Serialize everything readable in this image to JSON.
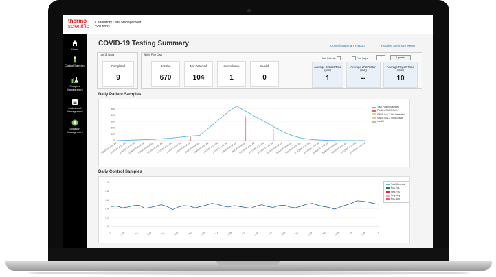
{
  "app": {
    "logo_line1": "thermo",
    "logo_line2": "scientific",
    "name": "Laboratory Data Management Solutions"
  },
  "sidebar": {
    "items": [
      {
        "label": "Home",
        "icon": "home-icon"
      },
      {
        "label": "Control Samples",
        "icon": "test-tube-icon"
      },
      {
        "label": "Reagent Management",
        "icon": "flask-icon"
      },
      {
        "label": "Instrument Management",
        "icon": "instrument-icon"
      },
      {
        "label": "Location Management",
        "icon": "location-icon"
      }
    ]
  },
  "page": {
    "title": "COVID-19 Testing Summary",
    "links": {
      "control": "Control Summary Report",
      "positive": "Positive Summary Report"
    }
  },
  "last24": {
    "label": "Last 24 hours",
    "cards": [
      {
        "label": "Completed",
        "value": "9"
      }
    ]
  },
  "within": {
    "label": "Within Prior Days",
    "cards": [
      {
        "label": "Positive",
        "value": "670"
      },
      {
        "label": "Not Detected",
        "value": "104"
      },
      {
        "label": "Inconclusive",
        "value": "1"
      },
      {
        "label": "Invalid",
        "value": "0"
      }
    ],
    "time_cards": [
      {
        "label": "Average Extract Time (min)",
        "value": "1"
      },
      {
        "label": "Average qPCR Start (min)",
        "value": "--"
      },
      {
        "label": "Average Report Time (min)",
        "value": "10"
      }
    ],
    "controls": {
      "auto_refresh": "Auto Refresh",
      "prior_days": "Prior Days",
      "prior_days_value": "7",
      "update": "Update"
    }
  },
  "colors": {
    "accent": "#1e6fb8",
    "brand": "#e3120b",
    "line": "#5ab4e5",
    "positive": "#e06666"
  },
  "chart_data": [
    {
      "type": "line",
      "title": "Daily Patient Samples",
      "yticks": [
        "0",
        "100",
        "200",
        "300",
        "400",
        "500"
      ],
      "ylim": [
        0,
        560
      ],
      "x": [
        "1/26/2020 12:00 AM",
        "1/27/2020 12:00 AM",
        "1/28/2020 12:00 AM",
        "1/29/2020 12:00 AM",
        "1/30/2020 12:00 AM",
        "1/31/2020 12:00 AM",
        "2/1/2020 12:00 AM",
        "2/2/2020 12:00 AM",
        "2/3/2020 12:00 AM",
        "2/4/2020 12:00 AM",
        "2/5/2020 12:00 AM",
        "2/6/2020 12:00 AM",
        "2/7/2020 12:00 AM",
        "2/8/2020 12:00 AM",
        "2/9/2020 12:00 AM",
        "2/10/2020 12:00 AM",
        "2/11/2020 12:00 AM",
        "2/12/2020 12:00 AM",
        "2/13/2020 12:00 AM",
        "2/14/2020 12:00 AM",
        "2/15/2020 12:00 AM",
        "2/16/2020 12:00 AM",
        "2/17/2020 12:00 AM",
        "2/18/2020 12:00 AM",
        "2/19/2020 12:00 AM",
        "2/20/2020 12:00 AM",
        "2/21/2020 12:00 AM",
        "2/22/2020 12:00 AM"
      ],
      "series": [
        {
          "name": "Total Patient Samples",
          "values": [
            0,
            5,
            10,
            15,
            20,
            30,
            40,
            55,
            70,
            80,
            200,
            320,
            440,
            540,
            460,
            380,
            300,
            220,
            140,
            80,
            40,
            20,
            10,
            5,
            2,
            0,
            0,
            0
          ]
        },
        {
          "name": "Positive SARS-CoV-2",
          "values": [
            0,
            0,
            0,
            0,
            0,
            0,
            0,
            0,
            0,
            0,
            0,
            0,
            0,
            0,
            0,
            0,
            0,
            0,
            0,
            0,
            0,
            0,
            0,
            0,
            0,
            0,
            0,
            0
          ]
        }
      ],
      "legend": [
        "Total Patient Samples",
        "Positive SARS-CoV-2",
        "SARS-CoV-2 Not Detected",
        "SARS-CoV-2 Inconclusive",
        "Invalid"
      ],
      "legend_colors": [
        "#5ab4e5",
        "#e06666",
        "#f6c89f",
        "#c9d59b",
        "#bbbbbb"
      ],
      "bars": [
        {
          "index": 8,
          "value": 60
        },
        {
          "index": 14,
          "value": 380
        },
        {
          "index": 17,
          "value": 180
        }
      ]
    },
    {
      "type": "line",
      "title": "Daily Control Samples",
      "yticks": [
        "0",
        "0.2",
        "0.4",
        "0.6",
        "0.8",
        "1"
      ],
      "ylim": [
        0,
        1
      ],
      "xticks": [
        "0",
        "0.05",
        "0.1",
        "0.15",
        "0.2",
        "0.25",
        "0.3",
        "0.35",
        "0.4",
        "0.45",
        "0.5",
        "0.55",
        "0.6",
        "0.65",
        "0.7",
        "0.75",
        "0.8",
        "0.85",
        "0.9",
        "0.95",
        "1"
      ],
      "series": [
        {
          "name": "Total Controls",
          "values": [
            0.45,
            0.46,
            0.42,
            0.44,
            0.47,
            0.48,
            0.41,
            0.43,
            0.46,
            0.49,
            0.45,
            0.38,
            0.44,
            0.47,
            0.46,
            0.42,
            0.45,
            0.48,
            0.52,
            0.5,
            0.46,
            0.44,
            0.47,
            0.45,
            0.43,
            0.41,
            0.46,
            0.49,
            0.45,
            0.43,
            0.47,
            0.48,
            0.44,
            0.42,
            0.46,
            0.5,
            0.52,
            0.48,
            0.45,
            0.43,
            0.39,
            0.44,
            0.48,
            0.52,
            0.58,
            0.57,
            0.55,
            0.52,
            0.5
          ]
        }
      ],
      "legend": [
        "Total Controls",
        "Pos-Pos",
        "Neg-Pos",
        "Neg-Neg",
        "Pos-Neg"
      ],
      "legend_colors": [
        "#5ab4e5",
        "#2e7d32",
        "#d32f2f",
        "#f6a6c1",
        "#e06666"
      ]
    }
  ]
}
